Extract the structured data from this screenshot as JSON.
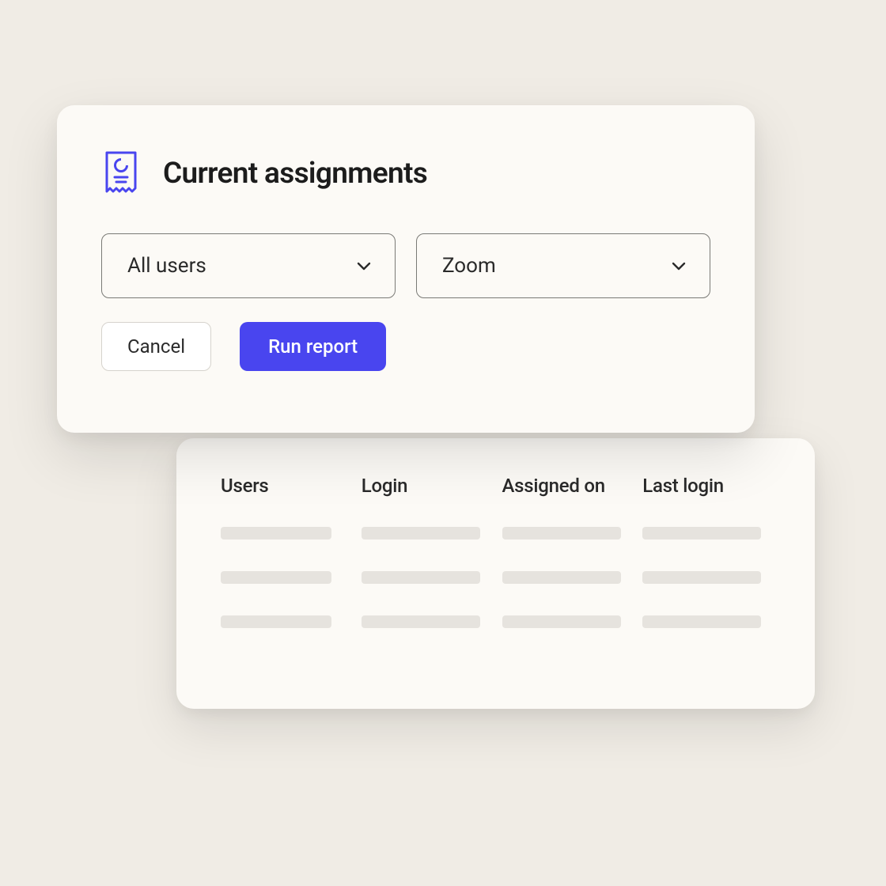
{
  "controls": {
    "title": "Current assignments",
    "select_users": "All users",
    "select_app": "Zoom",
    "cancel_label": "Cancel",
    "run_label": "Run report"
  },
  "results": {
    "columns": [
      "Users",
      "Login",
      "Assigned on",
      "Last login"
    ]
  },
  "colors": {
    "background": "#f0ece5",
    "card": "#fcfaf6",
    "primary": "#4945ef",
    "text": "#2a2a2a",
    "border": "#7a7a76",
    "skeleton": "#e6e3de"
  }
}
